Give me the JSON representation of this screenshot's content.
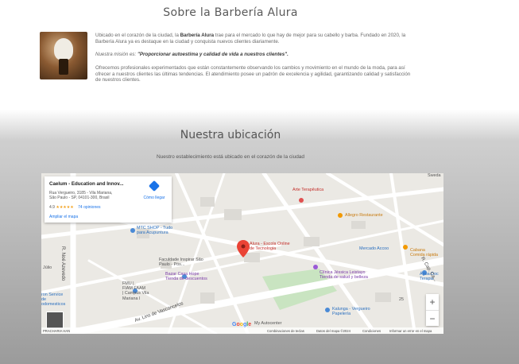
{
  "about": {
    "title": "Sobre la Barbería Alura",
    "p1_a": "Ubicado en el corazón de la ciudad, la ",
    "p1_b": "Barbería Alura",
    "p1_c": " trae para el mercado lo que hay de mejor para su cabello y barba. Fundado en 2020, la Barbería Alura ya es destaque en la ciudad y conquista nuevos clientes diariamente.",
    "p2_a": "Nuestra misión es: ",
    "p2_b": "\"Proporcionar autoestima y calidad de vida a nuestros clientes\".",
    "p3": "Ofrecemos profesionales experimentados que están constantemente observando los cambios y movimiento en el mundo de la moda, para así ofrecer a nuestros clientes las últimas tendencias. El atendimiento posee un padrón de excelencia y agilidad, garantizando calidad y satisfacción de nuestros clientes."
  },
  "location": {
    "title": "Nuestra ubicación",
    "subtitle": "Nuestro establecimiento está ubicado en el corazón de la ciudad"
  },
  "map": {
    "card": {
      "name": "Caelum - Education and Innov...",
      "address_1": "Rua Vergueiro, 3185 - Vila Mariana,",
      "address_2": "São Paulo - SP, 04101-300, Brasil",
      "rating": "4.9",
      "stars": "★★★★★",
      "reviews": "74 opiniones",
      "bigger_map": "Ampliar el mapa",
      "directions": "Cómo llegar"
    },
    "places": {
      "arte": "Arte Terapêutica",
      "allegro": "Allegro Restaurante",
      "mtc_1": "MTC SHOP - Tudo",
      "mtc_2": "para Acupuntura",
      "alura_1": "Alura - Escola Online",
      "alura_2": "de Tecnologia",
      "mercado": "Mercado Accoo",
      "cabana_1": "Cabana",
      "cabana_2": "Comida rápida",
      "facul_1": "Faculdade Inspirar São",
      "facul_2": "Paulo - Pós...",
      "bazar_1": "Bazar Casa Hope",
      "bazar_2": "Tienda de descuentos",
      "clinica_1": "Clínica Jéssica Leistayo",
      "clinica_2": "Tienda de salud y belleza",
      "agua_1": "Água Doc",
      "agua_2": "Terapia",
      "fmu_1": "FMU |",
      "fmu_2": "FIAM FAAM",
      "fmu_3": "| Campus Vila",
      "fmu_4": "Mariana I",
      "kalunga_1": "Kalunga - Vergueiro",
      "kalunga_2": "Papelería",
      "auto": "My Autocenter",
      "sweda": "Sweda",
      "ron_1": "ron Service",
      "ron_2": "de",
      "ron_3": "odomesticos",
      "juli": "Júlio",
      "num25": "25"
    },
    "streets": {
      "lins": "Av. Lins de Vasconcelos",
      "noe": "R. Noé Azevedo",
      "cap": "R. Cap. Ca..."
    },
    "zoom_in": "+",
    "zoom_out": "−",
    "google": [
      "G",
      "o",
      "o",
      "g",
      "l",
      "e"
    ],
    "attribution": {
      "keys": "Combinaciones de teclas",
      "data": "Datos del mapa ©2024",
      "terms": "Condiciones",
      "report": "Informar un error en el mapa",
      "corner": "PRACHARIA HAN"
    }
  }
}
